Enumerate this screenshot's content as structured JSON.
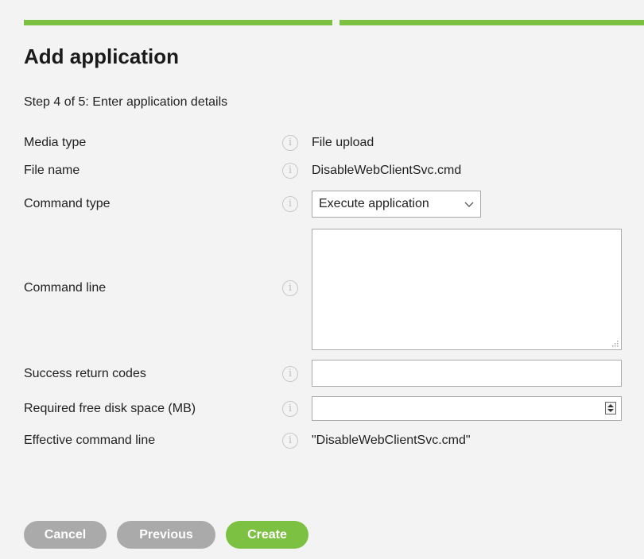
{
  "progress": {
    "segments_completed": 2,
    "segments_total": 2,
    "color": "#7dc143"
  },
  "title": "Add application",
  "step": "Step 4 of 5: Enter application details",
  "fields": {
    "media_type": {
      "label": "Media type",
      "value": "File upload"
    },
    "file_name": {
      "label": "File name",
      "value": "DisableWebClientSvc.cmd"
    },
    "command_type": {
      "label": "Command type",
      "selected": "Execute application"
    },
    "command_line": {
      "label": "Command line",
      "value": ""
    },
    "success_codes": {
      "label": "Success return codes",
      "value": ""
    },
    "disk_space": {
      "label": "Required free disk space (MB)",
      "value": ""
    },
    "effective_cmd": {
      "label": "Effective command line",
      "value": "\"DisableWebClientSvc.cmd\""
    }
  },
  "info_glyph": "i",
  "buttons": {
    "cancel": "Cancel",
    "previous": "Previous",
    "create": "Create"
  },
  "colors": {
    "accent": "#7dc143",
    "button_disabled": "#aaaaaa",
    "background": "#f3f3f3"
  }
}
